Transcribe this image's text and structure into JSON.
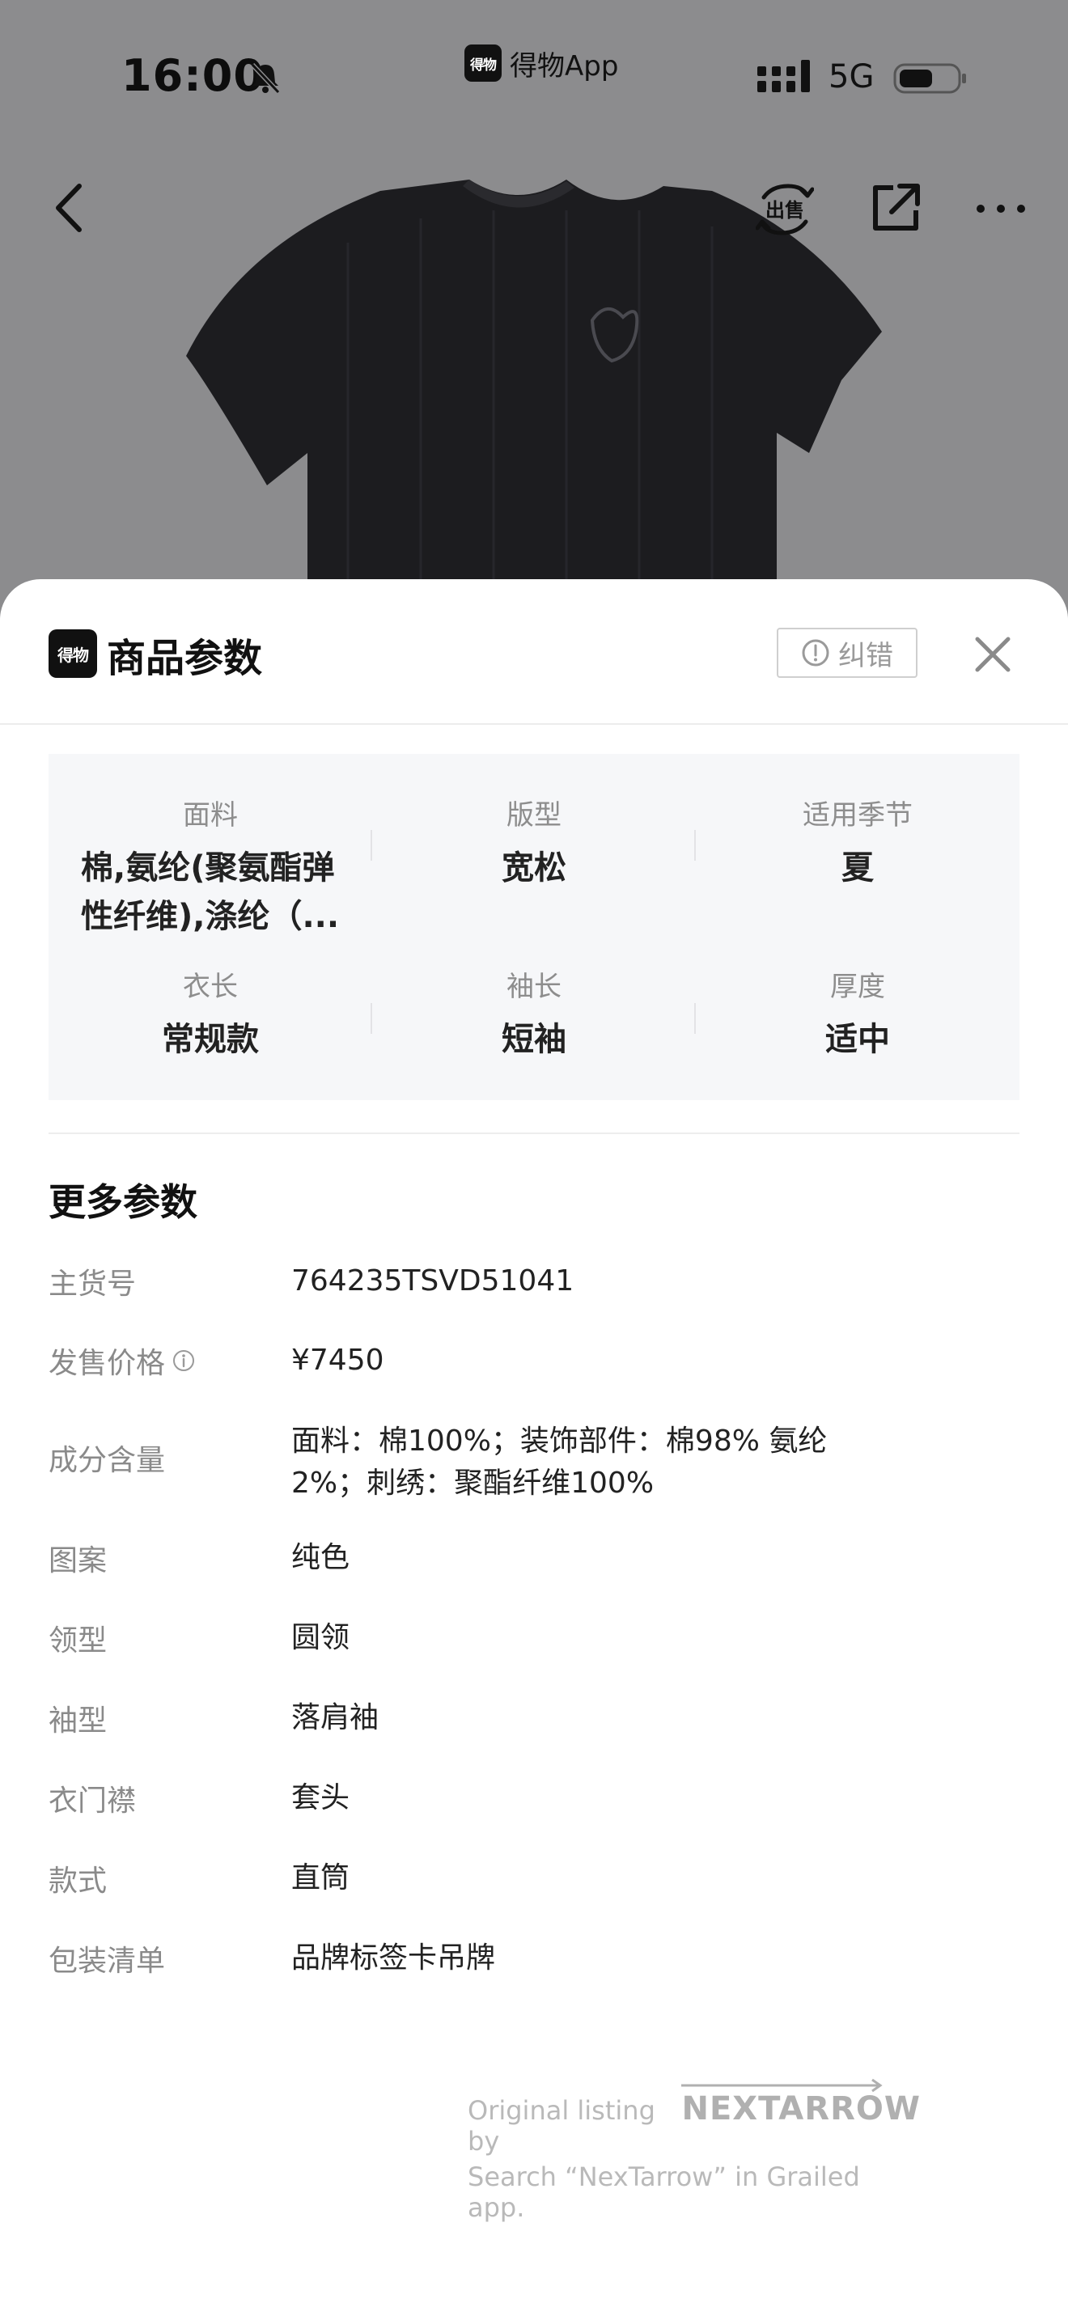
{
  "status_bar": {
    "time": "16:00",
    "app_name": "得物App",
    "app_logo_text": "得物",
    "network": "5G"
  },
  "nav": {
    "back_icon": "chevron-left-icon",
    "sell_icon": "sell-icon",
    "sell_text": "出售",
    "share_icon": "share-icon",
    "more_icon": "more-icon"
  },
  "sheet": {
    "logo_text": "得物",
    "title": "商品参数",
    "report_label": "纠错",
    "close_icon": "close-icon"
  },
  "params": [
    {
      "label": "面料",
      "value": "棉,氨纶(聚氨酯弹性纤维),涤纶（..."
    },
    {
      "label": "版型",
      "value": "宽松"
    },
    {
      "label": "适用季节",
      "value": "夏"
    },
    {
      "label": "衣长",
      "value": "常规款"
    },
    {
      "label": "袖长",
      "value": "短袖"
    },
    {
      "label": "厚度",
      "value": "适中"
    }
  ],
  "more": {
    "title": "更多参数",
    "rows": [
      {
        "key": "主货号",
        "value": "764235TSVD51041"
      },
      {
        "key": "发售价格",
        "value": "¥7450"
      },
      {
        "key": "成分含量",
        "value": "面料：棉100%；装饰部件：棉98% 氨纶2%；刺绣：聚酯纤维100%"
      },
      {
        "key": "图案",
        "value": "纯色"
      },
      {
        "key": "领型",
        "value": "圆领"
      },
      {
        "key": "袖型",
        "value": "落肩袖"
      },
      {
        "key": "衣门襟",
        "value": "套头"
      },
      {
        "key": "款式",
        "value": "直筒"
      },
      {
        "key": "包装清单",
        "value": "品牌标签卡吊牌"
      }
    ]
  },
  "watermark": {
    "prefix": "Original listing by",
    "brand": "NEXTARROW",
    "line2": "Search “NexTarrow” in Grailed app."
  },
  "colors": {
    "sheet_bg": "#ffffff",
    "grid_bg": "#f6f7f9",
    "label": "#8a8a8a",
    "value": "#222222"
  }
}
